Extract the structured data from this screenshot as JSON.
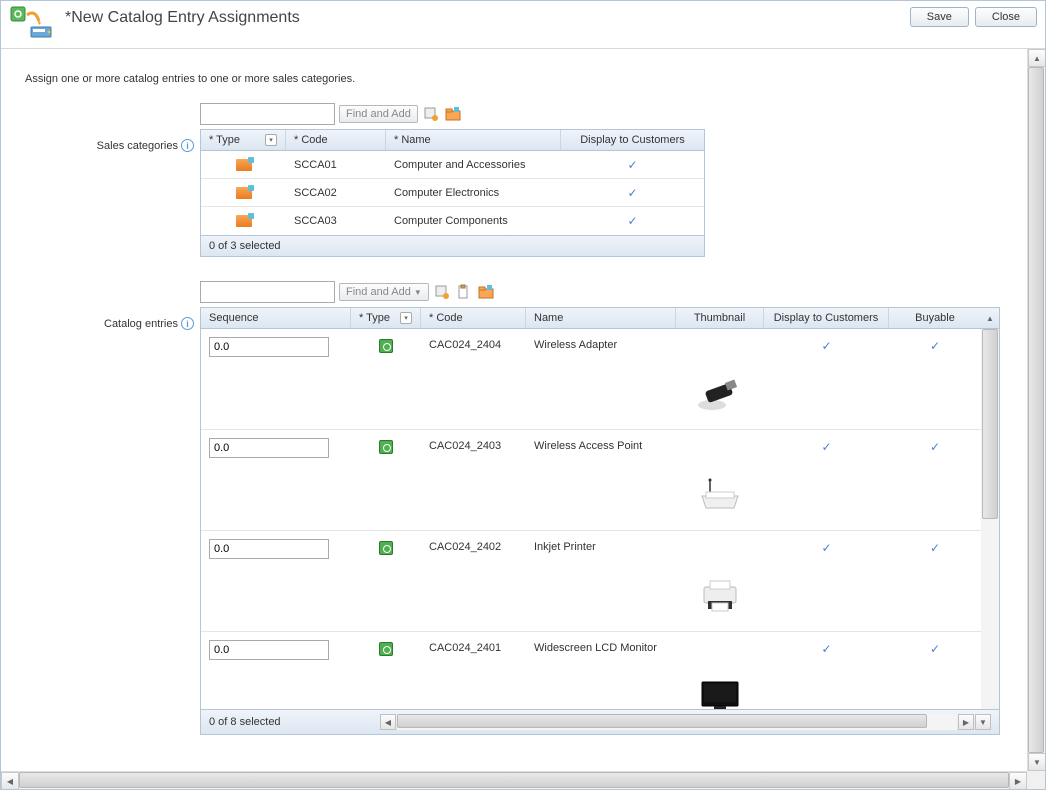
{
  "title": "*New Catalog Entry Assignments",
  "buttons": {
    "save": "Save",
    "close": "Close"
  },
  "intro": "Assign one or more catalog entries to one or more sales categories.",
  "categories": {
    "label": "Sales categories",
    "find_btn": "Find and Add",
    "headers": {
      "type": "* Type",
      "code": "* Code",
      "name": "* Name",
      "display": "Display to Customers"
    },
    "rows": [
      {
        "code": "SCCA01",
        "name": "Computer and Accessories",
        "display": true
      },
      {
        "code": "SCCA02",
        "name": "Computer Electronics",
        "display": true
      },
      {
        "code": "SCCA03",
        "name": "Computer Components",
        "display": true
      }
    ],
    "footer": "0 of 3 selected"
  },
  "entries": {
    "label": "Catalog entries",
    "find_btn": "Find and Add",
    "headers": {
      "sequence": "Sequence",
      "type": "* Type",
      "code": "* Code",
      "name": "Name",
      "thumbnail": "Thumbnail",
      "display": "Display to Customers",
      "buyable": "Buyable"
    },
    "rows": [
      {
        "sequence": "0.0",
        "code": "CAC024_2404",
        "name": "Wireless Adapter",
        "display": true,
        "buyable": true,
        "thumb": "usb"
      },
      {
        "sequence": "0.0",
        "code": "CAC024_2403",
        "name": "Wireless Access Point",
        "display": true,
        "buyable": true,
        "thumb": "router"
      },
      {
        "sequence": "0.0",
        "code": "CAC024_2402",
        "name": "Inkjet Printer",
        "display": true,
        "buyable": true,
        "thumb": "printer"
      },
      {
        "sequence": "0.0",
        "code": "CAC024_2401",
        "name": "Widescreen LCD Monitor",
        "display": true,
        "buyable": true,
        "thumb": "monitor"
      }
    ],
    "footer": "0 of 8 selected"
  }
}
